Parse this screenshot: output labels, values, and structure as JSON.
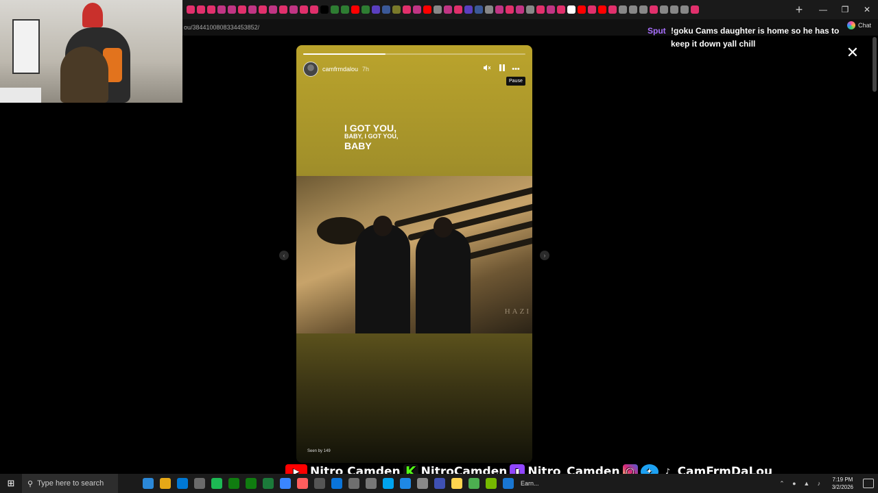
{
  "browser": {
    "tab_favicon_colors": [
      "#e1306c",
      "#e1306c",
      "#e1306c",
      "#c13584",
      "#c13584",
      "#e1306c",
      "#c13584",
      "#e1306c",
      "#c13584",
      "#e1306c",
      "#c13584",
      "#e1306c",
      "#e1306c",
      "#000000",
      "#2e7d32",
      "#2e7d32",
      "#ff0000",
      "#2e7d32",
      "#5a3fc0",
      "#3b5998",
      "#7a7a2a",
      "#e1306c",
      "#c13584",
      "#ff0000",
      "#888888",
      "#c13584",
      "#e1306c",
      "#5a3fc0",
      "#3b5998",
      "#888888",
      "#c13584",
      "#e1306c",
      "#c13584",
      "#888888",
      "#e1306c",
      "#c13584",
      "#e1306c",
      "#ffffff",
      "#ff0000",
      "#e1306c",
      "#ff0000",
      "#e1306c",
      "#888888",
      "#888888",
      "#888888",
      "#e1306c",
      "#888888",
      "#888888",
      "#888888",
      "#e1306c"
    ],
    "new_tab_icon": "plus-icon",
    "url": "ou/3844100808334453852/",
    "chat_label": "Chat"
  },
  "story": {
    "username": "camfrmdalou",
    "time_ago": "7h",
    "progress": 0.37,
    "tooltip": "Pause",
    "lyrics": [
      "I GOT YOU,",
      "BABY, I GOT YOU,",
      "BABY"
    ],
    "photo_caption": "HAZI",
    "seen_by": "Seen by 149",
    "icons": {
      "mute": "volume-icon",
      "pause": "pause-icon",
      "more": "more-icon",
      "close": "close-icon",
      "prev": "chevron-left-icon",
      "next": "chevron-right-icon"
    },
    "background_color": "#bba42c"
  },
  "stream_chat": {
    "user": "Sput",
    "message": "!goku Cams daughter is home so he has to keep it down yall chill",
    "user_color": "#a970ff"
  },
  "socials": {
    "youtube": "Nitro Camden",
    "kick": "NitroCamden",
    "twitch": "Nitro_Camden",
    "handle": "CamFrmDaLou"
  },
  "taskbar": {
    "search_placeholder": "Type here to search",
    "active_app_label": "Earn...",
    "time": "7:19 PM",
    "date": "3/2/2026",
    "app_colors": [
      "#2b88d8",
      "#e6a817",
      "#0078d4",
      "#6b6b6b",
      "#1db954",
      "#107c10",
      "#107c10",
      "#1b7a3a",
      "#3a86ff",
      "#ff5e5e",
      "#555555",
      "#0a74da",
      "#6f6f6f",
      "#777777",
      "#00a4ef",
      "#1e88e5",
      "#888888",
      "#3f51b5",
      "#ffd54f",
      "#4caf50",
      "#76b900",
      "#1976d2"
    ]
  }
}
